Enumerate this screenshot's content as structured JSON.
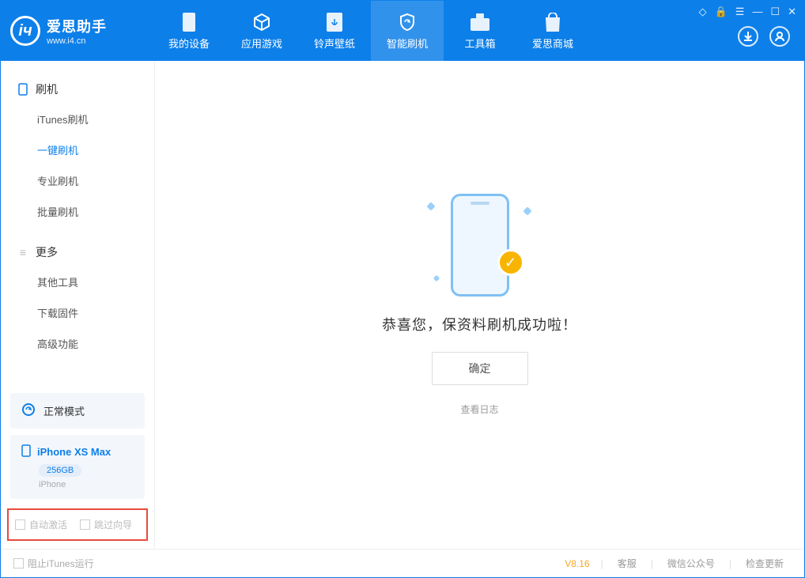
{
  "app": {
    "title": "爱思助手",
    "url": "www.i4.cn"
  },
  "nav": [
    {
      "label": "我的设备"
    },
    {
      "label": "应用游戏"
    },
    {
      "label": "铃声壁纸"
    },
    {
      "label": "智能刷机"
    },
    {
      "label": "工具箱"
    },
    {
      "label": "爱思商城"
    }
  ],
  "sidebar": {
    "section_flash": "刷机",
    "items_flash": [
      "iTunes刷机",
      "一键刷机",
      "专业刷机",
      "批量刷机"
    ],
    "section_more": "更多",
    "items_more": [
      "其他工具",
      "下载固件",
      "高级功能"
    ]
  },
  "status_mode": "正常模式",
  "device": {
    "name": "iPhone XS Max",
    "storage": "256GB",
    "type": "iPhone"
  },
  "options": {
    "auto_activate": "自动激活",
    "skip_guide": "跳过向导"
  },
  "main": {
    "success_message": "恭喜您，保资料刷机成功啦！",
    "ok_button": "确定",
    "view_log": "查看日志"
  },
  "footer": {
    "block_itunes": "阻止iTunes运行",
    "version": "V8.16",
    "links": [
      "客服",
      "微信公众号",
      "检查更新"
    ]
  }
}
